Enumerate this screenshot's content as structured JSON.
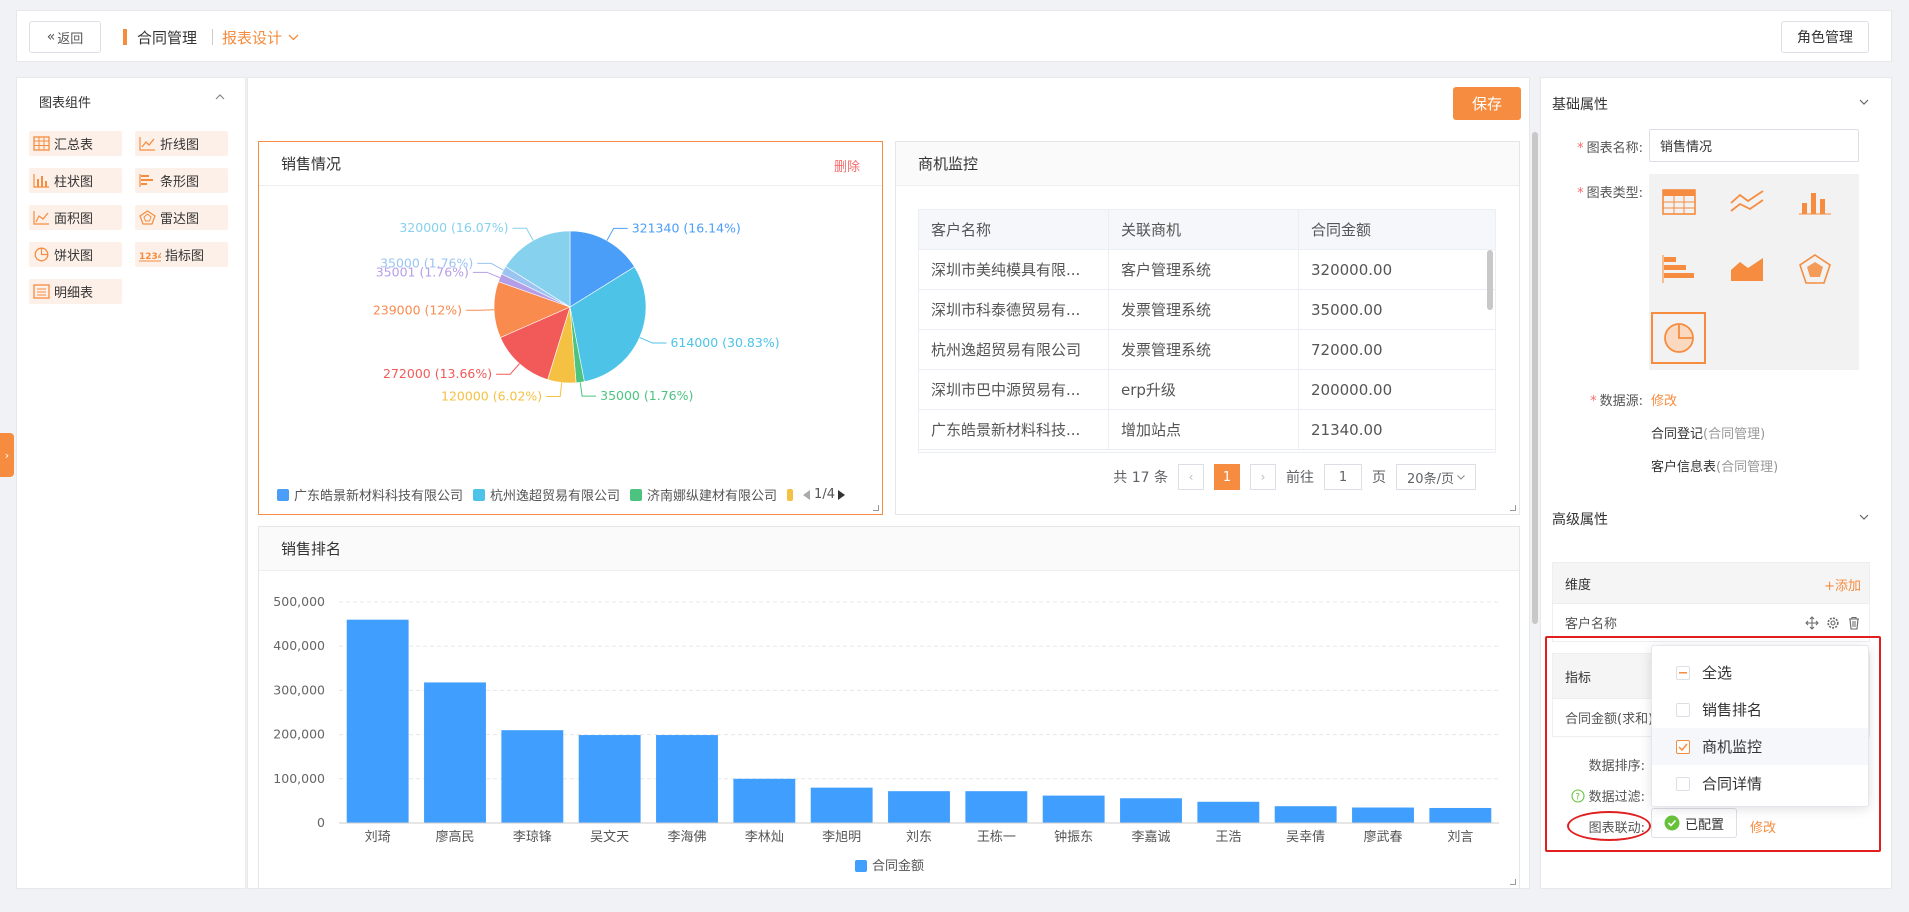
{
  "topbar": {
    "back_label": "返回",
    "crumb_module": "合同管理",
    "crumb_page": "报表设计",
    "role_button": "角色管理"
  },
  "left_panel": {
    "title": "图表组件",
    "components": [
      {
        "label": "汇总表",
        "icon": "summary-table-icon"
      },
      {
        "label": "折线图",
        "icon": "line-chart-icon"
      },
      {
        "label": "柱状图",
        "icon": "bar-chart-icon"
      },
      {
        "label": "条形图",
        "icon": "horizontal-bar-icon"
      },
      {
        "label": "面积图",
        "icon": "area-chart-icon"
      },
      {
        "label": "雷达图",
        "icon": "radar-chart-icon"
      },
      {
        "label": "饼状图",
        "icon": "pie-chart-icon"
      },
      {
        "label": "指标图",
        "icon": "indicator-icon",
        "icon_text": "1234"
      },
      {
        "label": "明细表",
        "icon": "detail-table-icon"
      }
    ]
  },
  "center": {
    "save_label": "保存",
    "pie_card": {
      "title": "销售情况",
      "delete_label": "删除",
      "legend": [
        "广东皓景新材料科技有限公司",
        "杭州逸超贸易有限公司",
        "济南娜纵建材有限公司"
      ],
      "legend_page": "1/4"
    },
    "table_card": {
      "title": "商机监控",
      "columns": [
        "客户名称",
        "关联商机",
        "合同金额"
      ],
      "rows": [
        [
          "深圳市美纯模具有限...",
          "客户管理系统",
          "320000.00"
        ],
        [
          "深圳市科泰德贸易有...",
          "发票管理系统",
          "35000.00"
        ],
        [
          "杭州逸超贸易有限公司",
          "发票管理系统",
          "72000.00"
        ],
        [
          "深圳市巴中源贸易有...",
          "erp升级",
          "200000.00"
        ],
        [
          "广东皓景新材料科技...",
          "增加站点",
          "21340.00"
        ]
      ],
      "pager": {
        "total": "共 17 条",
        "current": "1",
        "goto": "前往",
        "goto_value": "1",
        "page_unit": "页",
        "page_size": "20条/页"
      }
    },
    "bar_card": {
      "title": "销售排名"
    }
  },
  "chart_data": [
    {
      "type": "pie",
      "title": "销售情况",
      "slices": [
        {
          "label": "321340 (16.14%)",
          "value": 321340,
          "color": "#4a9ef8"
        },
        {
          "label": "614000 (30.83%)",
          "value": 614000,
          "color": "#4dc3e8"
        },
        {
          "label": "35000 (1.76%)",
          "value": 35000,
          "color": "#4cc37f"
        },
        {
          "label": "120000 (6.02%)",
          "value": 120000,
          "color": "#f5c142"
        },
        {
          "label": "272000 (13.66%)",
          "value": 272000,
          "color": "#f25a5a"
        },
        {
          "label": "239000 (12%)",
          "value": 239000,
          "color": "#f98b4f"
        },
        {
          "label": "35001 (1.76%)",
          "value": 35001,
          "color": "#b59ee8"
        },
        {
          "label": "35000 (1.76%)",
          "value": 35000,
          "color": "#9bc4f0"
        },
        {
          "label": "320000 (16.07%)",
          "value": 320000,
          "color": "#86d1ee"
        }
      ]
    },
    {
      "type": "bar",
      "title": "销售排名",
      "categories": [
        "刘琦",
        "廖高民",
        "李琼锋",
        "吴文天",
        "李海佛",
        "李林灿",
        "李旭明",
        "刘东",
        "王栋一",
        "钟振东",
        "李嘉诚",
        "王浩",
        "吴幸倩",
        "廖武春",
        "刘言"
      ],
      "series": [
        {
          "name": "合同金额",
          "values": [
            460000,
            318000,
            210000,
            199000,
            199000,
            100000,
            80000,
            72000,
            72000,
            62000,
            56000,
            48000,
            38000,
            35000,
            34000
          ],
          "color": "#409eff"
        }
      ],
      "ylim": [
        0,
        500000
      ],
      "yticks": [
        "500,000",
        "400,000",
        "300,000",
        "200,000",
        "100,000",
        "0"
      ],
      "grid": true,
      "legend": "bottom"
    }
  ],
  "right_panel": {
    "basic_title": "基础属性",
    "name_label": "图表名称:",
    "name_value": "销售情况",
    "type_label": "图表类型:",
    "datasource_label": "数据源:",
    "datasource_edit": "修改",
    "datasources": [
      {
        "name": "合同登记",
        "module": "(合同管理)"
      },
      {
        "name": "客户信息表",
        "module": "(合同管理)"
      }
    ],
    "advanced_title": "高级属性",
    "dimension": {
      "title": "维度",
      "add": "+添加",
      "item": "客户名称"
    },
    "metric": {
      "title": "指标",
      "item": "合同金额(求和)"
    },
    "sort_label": "数据排序:",
    "filter_label": "数据过滤:",
    "linkage_label": "图表联动:",
    "linkage_status": "已配置",
    "linkage_edit": "修改",
    "dropdown": [
      {
        "label": "全选",
        "state": "partial"
      },
      {
        "label": "销售排名",
        "state": "unchecked"
      },
      {
        "label": "商机监控",
        "state": "checked"
      },
      {
        "label": "合同详情",
        "state": "unchecked"
      }
    ]
  },
  "colors": {
    "accent": "#f58c3f",
    "danger": "#f56c6c",
    "highlight": "#e02020",
    "bar": "#409eff"
  }
}
